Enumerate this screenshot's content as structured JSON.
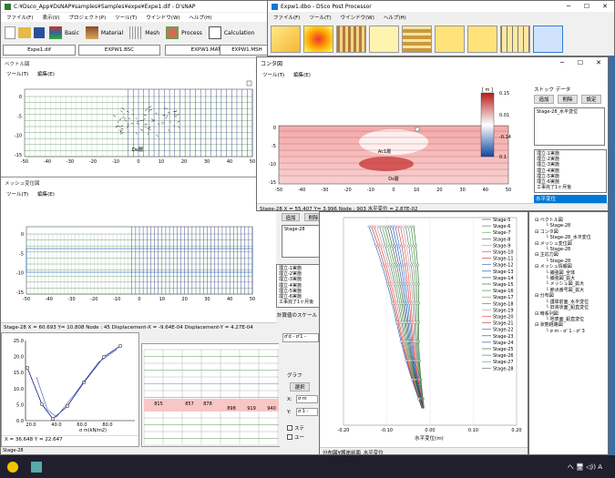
{
  "main_window": {
    "title": "C:¥Dsco_App¥DsNAP¥samples¥Samples¥expe¥Expe1.dif - D'sNAP",
    "menu": [
      "ファイル(F)",
      "表示(V)",
      "プロジェクト(P)",
      "ツール(T)",
      "ウインドウ(W)",
      "ヘルプ(H)"
    ],
    "toolbar": [
      "Basic",
      "Material",
      "Mesh",
      "Process",
      "Calculation"
    ],
    "tabs": [
      "Expe1.dif",
      "EXPW1.BSC",
      "EXPW1.MAT",
      "EXPW1.MSH"
    ]
  },
  "vector_panel": {
    "title": "ベクトル図",
    "menu": [
      "ツール(T)",
      "編集(E)"
    ],
    "x_ticks": [
      "-50",
      "-40",
      "-30",
      "-20",
      "-10",
      "0",
      "10",
      "20",
      "30",
      "40",
      "50"
    ],
    "y_ticks": [
      "0",
      "-5",
      "-10",
      "-15"
    ],
    "label": "Ds層"
  },
  "mesh_panel": {
    "title": "メッシュ変位図",
    "menu": [
      "ツール(T)",
      "編集(E)"
    ],
    "x_ticks": [
      "-50",
      "-40",
      "-30",
      "-20",
      "-10",
      "0",
      "10",
      "20",
      "30",
      "40",
      "50"
    ],
    "y_ticks": [
      "0",
      "-5",
      "-10",
      "-15"
    ],
    "status": "Stage-28    X = 60.693  Y= 10.808  Node : 45  Displacement-X = -9.64E-04  Displacement-Y = 4.27E-04"
  },
  "post_window": {
    "title": "Expw1.dbo - DSco Post Processor",
    "menu": [
      "ファイル(F)",
      "ツール(T)",
      "ウインドウ(W)",
      "ヘルプ(H)"
    ]
  },
  "contour_window": {
    "title": "コンタ図",
    "menu": [
      "ツール(T)",
      "編集(E)"
    ],
    "stock_title": "ストック データ",
    "buttons": [
      "追加",
      "削除",
      "設定"
    ],
    "stock_item": "Stage-28_水平変位",
    "stage_list": [
      "埋立-1実施",
      "埋立-2実施",
      "埋立-3実施",
      "埋立-4実施",
      "埋立-5実施",
      "埋立-6実施",
      "工事完了1ヶ月後"
    ],
    "selected": "水平変位",
    "legend_unit": "[ m ]",
    "legend_values": [
      "0.15",
      "0.01",
      "-0.14",
      "0.1"
    ],
    "x_ticks": [
      "-50",
      "-40",
      "-30",
      "-20",
      "-10",
      "0",
      "10",
      "20",
      "30",
      "40",
      "50"
    ],
    "y_ticks": [
      "0",
      "-5",
      "-10",
      "-15"
    ],
    "labels": [
      "Ac1層",
      "Ds層"
    ],
    "status": "Stage-28   X = 55.407  Y= 3.996  Node : 903  水平変位 = 2.87E-02"
  },
  "stock_panel2": {
    "buttons": [
      "追加",
      "削除",
      "設定"
    ],
    "stock_item": "Stage-28",
    "stage_list": [
      "埋立-1実施",
      "埋立-2実施",
      "埋立-3実施",
      "埋立-4実施",
      "埋立-5実施",
      "埋立-6実施",
      "工事完了1ヶ月後"
    ],
    "footer": "計算値のスケール"
  },
  "graph_panel": {
    "label": "グラフ",
    "select_btn": "選択",
    "x_label": "X:",
    "y_label": "Y:",
    "x_value": "σ m",
    "y_value": "σ 1 -",
    "check1": "ステ",
    "check2": "ユー",
    "combo": "σ'd - σ'1 -"
  },
  "stress_chart": {
    "y_ticks": [
      "25.0",
      "20.0",
      "15.0",
      "10.0",
      "5.0",
      "0.0"
    ],
    "x_ticks": [
      "20.0",
      "40.0",
      "60.0",
      "80.0"
    ],
    "xlabel": "σ m(kN/m2)",
    "status": "X = 36.648   Y = 22.647",
    "stage": "Stage-28"
  },
  "table_values": [
    "815",
    "857",
    "878",
    "898",
    "919",
    "940"
  ],
  "profile_chart": {
    "xlabel": "水平変位(m)",
    "x_ticks": [
      "-0.20",
      "-0.10",
      "0.00",
      "0.10",
      "0.20"
    ],
    "status": "分布図¥護岸前面_水平変位",
    "stages": [
      "Stage-5",
      "Stage-6",
      "Stage-7",
      "Stage-8",
      "Stage-9",
      "Stage-10",
      "Stage-11",
      "Stage-12",
      "Stage-13",
      "Stage-14",
      "Stage-15",
      "Stage-16",
      "Stage-17",
      "Stage-18",
      "Stage-19",
      "Stage-20",
      "Stage-21",
      "Stage-22",
      "Stage-23",
      "Stage-24",
      "Stage-25",
      "Stage-26",
      "Stage-27",
      "Stage-28"
    ]
  },
  "tree": [
    "ベクトル図",
    "Stage-28",
    "コンタ図",
    "Stage-28_水平変位",
    "メッシュ変位図",
    "Stage-28",
    "主応力図",
    "Stage-28",
    "メッシュ情報図",
    "補強図_全体",
    "補強図_拡大",
    "メッシュ図_拡大",
    "節点番号図_拡大",
    "分布図",
    "護岸前面_水平変位",
    "旧液状面_鉛直変位",
    "時系列図",
    "地表面_鉛直変位",
    "状態経路図",
    "σ m - σ' 1 - σ' 3"
  ],
  "taskbar": {
    "tray": "へ 🖥 ◁)) A"
  }
}
